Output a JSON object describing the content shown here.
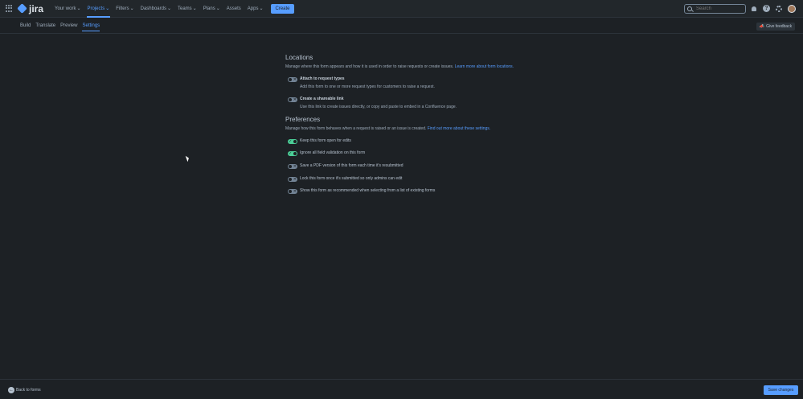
{
  "app": {
    "name": "jira"
  },
  "nav": {
    "items": [
      {
        "label": "Your work",
        "caret": "⌄"
      },
      {
        "label": "Projects",
        "caret": "⌄"
      },
      {
        "label": "Filters",
        "caret": "⌄"
      },
      {
        "label": "Dashboards",
        "caret": "⌄"
      },
      {
        "label": "Teams",
        "caret": "⌄"
      },
      {
        "label": "Plans",
        "caret": "⌄"
      },
      {
        "label": "Assets",
        "caret": ""
      },
      {
        "label": "Apps",
        "caret": "⌄"
      }
    ],
    "active": "Projects",
    "create_label": "Create",
    "search_placeholder": "Search"
  },
  "subnav": {
    "tabs": [
      {
        "label": "Build"
      },
      {
        "label": "Translate"
      },
      {
        "label": "Preview"
      },
      {
        "label": "Settings"
      }
    ],
    "active": "Settings",
    "feedback_label": "Give feedback"
  },
  "locations": {
    "title": "Locations",
    "description": "Manage where this form appears and how it is used in order to raise requests or create issues.",
    "link": "Learn more about form locations.",
    "options": [
      {
        "label": "Attach to request types",
        "description": "Add this form to one or more request types for customers to raise a request.",
        "enabled": false
      },
      {
        "label": "Create a shareable link",
        "description": "Use this link to create issues directly, or copy and paste to embed in a Confluence page.",
        "enabled": false
      }
    ]
  },
  "preferences": {
    "title": "Preferences",
    "description": "Manage how this form behaves when a request is raised or an issue is created.",
    "link": "Find out more about these settings.",
    "options": [
      {
        "label": "Keep this form open for edits",
        "enabled": true
      },
      {
        "label": "Ignore all field validation on this form",
        "enabled": true
      },
      {
        "label": "Save a PDF version of this form each time it's resubmitted",
        "enabled": false
      },
      {
        "label": "Lock this form once it's submitted so only admins can edit",
        "enabled": false
      },
      {
        "label": "Show this form as recommended when selecting from a list of existing forms",
        "enabled": false
      }
    ]
  },
  "footer": {
    "back_label": "Back to forms",
    "save_label": "Save changes"
  },
  "colors": {
    "accent": "#579dff",
    "toggle_on": "#4bce97",
    "toggle_off": "#738496",
    "background": "#1d2125"
  },
  "icons": {
    "toggle_on_mark": "✓",
    "toggle_off_mark": "✕",
    "back": "←",
    "feedback": "📣"
  }
}
